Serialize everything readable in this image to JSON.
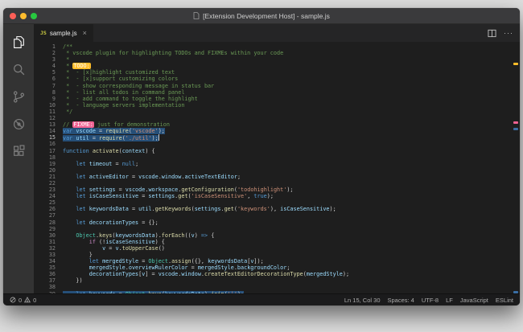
{
  "window": {
    "title": "[Extension Development Host] - sample.js",
    "traffic_lights": {
      "close": "#ff5f57",
      "minimize": "#febc2e",
      "zoom": "#28c840"
    }
  },
  "activity_bar": {
    "items": [
      "explorer",
      "search",
      "source-control",
      "debug",
      "extensions"
    ],
    "active_item": "explorer"
  },
  "tab_bar": {
    "tabs": [
      {
        "label": "sample.js",
        "icon": "JS",
        "close_glyph": "×",
        "active": true
      }
    ],
    "actions": [
      {
        "name": "split-editor"
      },
      {
        "name": "more-actions",
        "glyph": "···"
      }
    ]
  },
  "editor": {
    "language": "javascript",
    "cursor_line": 15,
    "selection_color": "#264f78",
    "highlight_colors": {
      "todo_bg": "#ffbd2a",
      "fixme_bg": "#f06292"
    },
    "ruler_marks": [
      {
        "line": 4,
        "color": "#ffbd2a"
      },
      {
        "line": 13,
        "color": "#f06292"
      },
      {
        "line": 14,
        "color": "#3a6ea5"
      },
      {
        "line": 39,
        "color": "#3a6ea5"
      }
    ],
    "lines": [
      {
        "n": 1,
        "segs": [
          [
            "cm",
            "/**"
          ]
        ]
      },
      {
        "n": 2,
        "segs": [
          [
            "cm",
            " * vscode plugin for highlighting TODOs and FIXMEs within your code"
          ]
        ]
      },
      {
        "n": 3,
        "segs": [
          [
            "cm",
            " *"
          ]
        ]
      },
      {
        "n": 4,
        "segs": [
          [
            "cm",
            " * "
          ],
          [
            "todo",
            "TODO:"
          ]
        ]
      },
      {
        "n": 5,
        "segs": [
          [
            "cm",
            " *  - [x]highlight customized text"
          ]
        ]
      },
      {
        "n": 6,
        "segs": [
          [
            "cm",
            " *  - [x]support customizing colors"
          ]
        ]
      },
      {
        "n": 7,
        "segs": [
          [
            "cm",
            " *  - show corresponding message in status bar"
          ]
        ]
      },
      {
        "n": 8,
        "segs": [
          [
            "cm",
            " *  - list all todos in command panel"
          ]
        ]
      },
      {
        "n": 9,
        "segs": [
          [
            "cm",
            " *  - add command to toggle the highlight"
          ]
        ]
      },
      {
        "n": 10,
        "segs": [
          [
            "cm",
            " *  - language servers implementation"
          ]
        ]
      },
      {
        "n": 11,
        "segs": [
          [
            "cm",
            " */"
          ]
        ]
      },
      {
        "n": 12,
        "segs": []
      },
      {
        "n": 13,
        "segs": [
          [
            "cm",
            "// "
          ],
          [
            "fixme",
            "FIXME:"
          ],
          [
            "cm",
            " just for demonstration"
          ]
        ]
      },
      {
        "n": 14,
        "sel": true,
        "segs": [
          [
            "kw",
            "var"
          ],
          [
            "pn",
            " "
          ],
          [
            "vr",
            "vscode"
          ],
          [
            "pn",
            " = "
          ],
          [
            "fn",
            "require"
          ],
          [
            "pn",
            "("
          ],
          [
            "str",
            "'vscode'"
          ],
          [
            "pn",
            ");"
          ]
        ]
      },
      {
        "n": 15,
        "sel": true,
        "cursor": true,
        "segs": [
          [
            "kw",
            "var"
          ],
          [
            "pn",
            " "
          ],
          [
            "vr",
            "util"
          ],
          [
            "pn",
            " = "
          ],
          [
            "fn",
            "require"
          ],
          [
            "pn",
            "("
          ],
          [
            "str",
            "'./util'"
          ],
          [
            "pn",
            ");"
          ]
        ]
      },
      {
        "n": 16,
        "segs": []
      },
      {
        "n": 17,
        "segs": [
          [
            "kw",
            "function"
          ],
          [
            "pn",
            " "
          ],
          [
            "fn",
            "activate"
          ],
          [
            "pn",
            "("
          ],
          [
            "vr",
            "context"
          ],
          [
            "pn",
            ") {"
          ]
        ]
      },
      {
        "n": 18,
        "segs": []
      },
      {
        "n": 19,
        "segs": [
          [
            "pn",
            "    "
          ],
          [
            "kw",
            "let"
          ],
          [
            "pn",
            " "
          ],
          [
            "vr",
            "timeout"
          ],
          [
            "pn",
            " = "
          ],
          [
            "kw",
            "null"
          ],
          [
            "pn",
            ";"
          ]
        ]
      },
      {
        "n": 20,
        "segs": []
      },
      {
        "n": 21,
        "segs": [
          [
            "pn",
            "    "
          ],
          [
            "kw",
            "let"
          ],
          [
            "pn",
            " "
          ],
          [
            "vr",
            "activeEditor"
          ],
          [
            "pn",
            " = "
          ],
          [
            "vr",
            "vscode"
          ],
          [
            "pn",
            "."
          ],
          [
            "vr",
            "window"
          ],
          [
            "pn",
            "."
          ],
          [
            "vr",
            "activeTextEditor"
          ],
          [
            "pn",
            ";"
          ]
        ]
      },
      {
        "n": 22,
        "segs": []
      },
      {
        "n": 23,
        "segs": [
          [
            "pn",
            "    "
          ],
          [
            "kw",
            "let"
          ],
          [
            "pn",
            " "
          ],
          [
            "vr",
            "settings"
          ],
          [
            "pn",
            " = "
          ],
          [
            "vr",
            "vscode"
          ],
          [
            "pn",
            "."
          ],
          [
            "vr",
            "workspace"
          ],
          [
            "pn",
            "."
          ],
          [
            "fn",
            "getConfiguration"
          ],
          [
            "pn",
            "("
          ],
          [
            "str",
            "'todohighlight'"
          ],
          [
            "pn",
            ");"
          ]
        ]
      },
      {
        "n": 24,
        "segs": [
          [
            "pn",
            "    "
          ],
          [
            "kw",
            "let"
          ],
          [
            "pn",
            " "
          ],
          [
            "vr",
            "isCaseSensitive"
          ],
          [
            "pn",
            " = "
          ],
          [
            "vr",
            "settings"
          ],
          [
            "pn",
            "."
          ],
          [
            "fn",
            "get"
          ],
          [
            "pn",
            "("
          ],
          [
            "str",
            "'isCaseSensitive'"
          ],
          [
            "pn",
            ", "
          ],
          [
            "kw",
            "true"
          ],
          [
            "pn",
            ");"
          ]
        ]
      },
      {
        "n": 25,
        "segs": []
      },
      {
        "n": 26,
        "segs": [
          [
            "pn",
            "    "
          ],
          [
            "kw",
            "let"
          ],
          [
            "pn",
            " "
          ],
          [
            "vr",
            "keywordsData"
          ],
          [
            "pn",
            " = "
          ],
          [
            "vr",
            "util"
          ],
          [
            "pn",
            "."
          ],
          [
            "fn",
            "getKeywords"
          ],
          [
            "pn",
            "("
          ],
          [
            "vr",
            "settings"
          ],
          [
            "pn",
            "."
          ],
          [
            "fn",
            "get"
          ],
          [
            "pn",
            "("
          ],
          [
            "str",
            "'keywords'"
          ],
          [
            "pn",
            "), "
          ],
          [
            "vr",
            "isCaseSensitive"
          ],
          [
            "pn",
            ");"
          ]
        ]
      },
      {
        "n": 27,
        "segs": []
      },
      {
        "n": 28,
        "segs": [
          [
            "pn",
            "    "
          ],
          [
            "kw",
            "let"
          ],
          [
            "pn",
            " "
          ],
          [
            "vr",
            "decorationTypes"
          ],
          [
            "pn",
            " = {};"
          ]
        ]
      },
      {
        "n": 29,
        "segs": []
      },
      {
        "n": 30,
        "segs": [
          [
            "pn",
            "    "
          ],
          [
            "cls",
            "Object"
          ],
          [
            "pn",
            "."
          ],
          [
            "fn",
            "keys"
          ],
          [
            "pn",
            "("
          ],
          [
            "vr",
            "keywordsData"
          ],
          [
            "pn",
            ")."
          ],
          [
            "fn",
            "forEach"
          ],
          [
            "pn",
            "(("
          ],
          [
            "vr",
            "v"
          ],
          [
            "pn",
            ") "
          ],
          [
            "kw",
            "=>"
          ],
          [
            "pn",
            " {"
          ]
        ]
      },
      {
        "n": 31,
        "segs": [
          [
            "pn",
            "        "
          ],
          [
            "ctl",
            "if"
          ],
          [
            "pn",
            " (!"
          ],
          [
            "vr",
            "isCaseSensitive"
          ],
          [
            "pn",
            ") {"
          ]
        ]
      },
      {
        "n": 32,
        "segs": [
          [
            "pn",
            "            "
          ],
          [
            "vr",
            "v"
          ],
          [
            "pn",
            " = "
          ],
          [
            "vr",
            "v"
          ],
          [
            "pn",
            "."
          ],
          [
            "fn",
            "toUpperCase"
          ],
          [
            "pn",
            "()"
          ]
        ]
      },
      {
        "n": 33,
        "segs": [
          [
            "pn",
            "        }"
          ]
        ]
      },
      {
        "n": 34,
        "segs": [
          [
            "pn",
            "        "
          ],
          [
            "kw",
            "let"
          ],
          [
            "pn",
            " "
          ],
          [
            "vr",
            "mergedStyle"
          ],
          [
            "pn",
            " = "
          ],
          [
            "cls",
            "Object"
          ],
          [
            "pn",
            "."
          ],
          [
            "fn",
            "assign"
          ],
          [
            "pn",
            "({}, "
          ],
          [
            "vr",
            "keywordsData"
          ],
          [
            "pn",
            "["
          ],
          [
            "vr",
            "v"
          ],
          [
            "pn",
            "]);"
          ]
        ]
      },
      {
        "n": 35,
        "segs": [
          [
            "pn",
            "        "
          ],
          [
            "vr",
            "mergedStyle"
          ],
          [
            "pn",
            "."
          ],
          [
            "vr",
            "overviewRulerColor"
          ],
          [
            "pn",
            " = "
          ],
          [
            "vr",
            "mergedStyle"
          ],
          [
            "pn",
            "."
          ],
          [
            "vr",
            "backgroundColor"
          ],
          [
            "pn",
            ";"
          ]
        ]
      },
      {
        "n": 36,
        "segs": [
          [
            "pn",
            "        "
          ],
          [
            "vr",
            "decorationTypes"
          ],
          [
            "pn",
            "["
          ],
          [
            "vr",
            "v"
          ],
          [
            "pn",
            "] = "
          ],
          [
            "vr",
            "vscode"
          ],
          [
            "pn",
            "."
          ],
          [
            "vr",
            "window"
          ],
          [
            "pn",
            "."
          ],
          [
            "fn",
            "createTextEditorDecorationType"
          ],
          [
            "pn",
            "("
          ],
          [
            "vr",
            "mergedStyle"
          ],
          [
            "pn",
            ");"
          ]
        ]
      },
      {
        "n": 37,
        "segs": [
          [
            "pn",
            "    })"
          ]
        ]
      },
      {
        "n": 38,
        "segs": []
      },
      {
        "n": 39,
        "sel": true,
        "segs": [
          [
            "pn",
            "    "
          ],
          [
            "kw",
            "let"
          ],
          [
            "pn",
            " "
          ],
          [
            "vr",
            "keywords"
          ],
          [
            "pn",
            " = "
          ],
          [
            "cls",
            "Object"
          ],
          [
            "pn",
            "."
          ],
          [
            "fn",
            "keys"
          ],
          [
            "pn",
            "("
          ],
          [
            "vr",
            "keywordsData"
          ],
          [
            "pn",
            ")."
          ],
          [
            "fn",
            "join"
          ],
          [
            "pn",
            "("
          ],
          [
            "str",
            "'|'"
          ],
          [
            "pn",
            ");"
          ]
        ]
      }
    ]
  },
  "status_bar": {
    "errors": "0",
    "warnings": "0",
    "right": [
      {
        "name": "cursor-position",
        "label": "Ln 15, Col 30"
      },
      {
        "name": "indentation",
        "label": "Spaces: 4"
      },
      {
        "name": "encoding",
        "label": "UTF-8"
      },
      {
        "name": "eol",
        "label": "LF"
      },
      {
        "name": "language-mode",
        "label": "JavaScript"
      },
      {
        "name": "eslint-status",
        "label": "ESLint"
      }
    ]
  }
}
